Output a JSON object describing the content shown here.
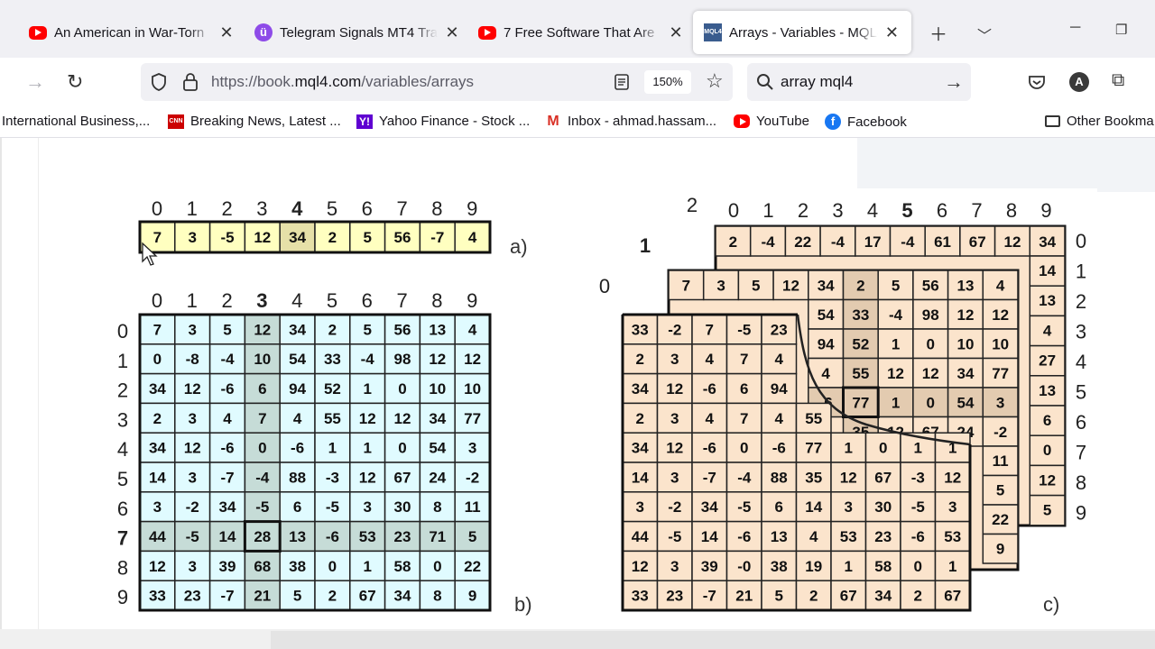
{
  "tabs": [
    {
      "title": "An American in War-Torn",
      "icon": "youtube-icon"
    },
    {
      "title": "Telegram Signals MT4 Tra",
      "icon": "telegram-icon"
    },
    {
      "title": "7 Free Software That Are",
      "icon": "youtube-icon"
    },
    {
      "title": "Arrays - Variables - MQL4",
      "icon": "mql4-icon",
      "active": true
    }
  ],
  "toolbar": {
    "url_prefix": "https://book.",
    "url_domain": "mql4.com",
    "url_path": "/variables/arrays",
    "zoom": "150%",
    "search_query": "array mql4",
    "account_initial": "A"
  },
  "bookmarks": [
    {
      "label": "International Business,...",
      "icon": "none"
    },
    {
      "label": "Breaking News, Latest ...",
      "icon": "cnn-icon",
      "icon_text": "CNN"
    },
    {
      "label": "Yahoo Finance - Stock ...",
      "icon": "yahoo-icon",
      "icon_text": "Y!"
    },
    {
      "label": "Inbox - ahmad.hassam...",
      "icon": "gmail-icon",
      "icon_text": "M"
    },
    {
      "label": "YouTube",
      "icon": "youtube-icon"
    },
    {
      "label": "Facebook",
      "icon": "facebook-icon",
      "icon_text": "f"
    },
    {
      "label": "Other Bookma",
      "icon": "folder-icon"
    }
  ],
  "figure": {
    "label_a": "a)",
    "label_b": "b)",
    "label_c": "c)",
    "col_index": [
      "0",
      "1",
      "2",
      "3",
      "4",
      "5",
      "6",
      "7",
      "8",
      "9"
    ],
    "row_index": [
      "0",
      "1",
      "2",
      "3",
      "4",
      "5",
      "6",
      "7",
      "8",
      "9"
    ],
    "array_1d": [
      "7",
      "3",
      "-5",
      "12",
      "34",
      "2",
      "5",
      "56",
      "-7",
      "4"
    ],
    "array_2d": [
      [
        "7",
        "3",
        "5",
        "12",
        "34",
        "2",
        "5",
        "56",
        "13",
        "4"
      ],
      [
        "0",
        "-8",
        "-4",
        "10",
        "54",
        "33",
        "-4",
        "98",
        "12",
        "12"
      ],
      [
        "34",
        "12",
        "-6",
        "6",
        "94",
        "52",
        "1",
        "0",
        "10",
        "10"
      ],
      [
        "2",
        "3",
        "4",
        "7",
        "4",
        "55",
        "12",
        "12",
        "34",
        "77"
      ],
      [
        "34",
        "12",
        "-6",
        "0",
        "-6",
        "1",
        "1",
        "0",
        "54",
        "3"
      ],
      [
        "14",
        "3",
        "-7",
        "-4",
        "88",
        "-3",
        "12",
        "67",
        "24",
        "-2"
      ],
      [
        "3",
        "-2",
        "34",
        "-5",
        "6",
        "-5",
        "3",
        "30",
        "8",
        "11"
      ],
      [
        "44",
        "-5",
        "14",
        "28",
        "13",
        "-6",
        "53",
        "23",
        "71",
        "5"
      ],
      [
        "12",
        "3",
        "39",
        "68",
        "38",
        "0",
        "1",
        "58",
        "0",
        "22"
      ],
      [
        "33",
        "23",
        "-7",
        "21",
        "5",
        "2",
        "67",
        "34",
        "8",
        "9"
      ]
    ],
    "array_3d_depth_index": [
      "0",
      "1",
      "2"
    ],
    "array_3d_back_row0": [
      "2",
      "-4",
      "22",
      "-4",
      "17",
      "-4",
      "61",
      "67",
      "12",
      "34"
    ],
    "array_3d_back_right": [
      "14",
      "13",
      "4",
      "27",
      "13",
      "6",
      "0",
      "12",
      "5"
    ],
    "array_3d_mid": [
      [
        "7",
        "3",
        "5",
        "12",
        "34",
        "2",
        "5",
        "56",
        "13",
        "4"
      ],
      [
        "",
        "",
        "",
        "",
        "54",
        "33",
        "-4",
        "98",
        "12",
        "12"
      ],
      [
        "",
        "",
        "",
        "",
        "94",
        "52",
        "1",
        "0",
        "10",
        "10"
      ],
      [
        "",
        "",
        "",
        "",
        "4",
        "55",
        "12",
        "12",
        "34",
        "77"
      ],
      [
        "",
        "",
        "",
        "",
        "-6",
        "77",
        "1",
        "0",
        "54",
        "3"
      ],
      [
        "",
        "",
        "",
        "",
        "",
        "35",
        "12",
        "67",
        "24",
        "-2"
      ]
    ],
    "array_3d_mid_right": [
      "11",
      "5",
      "22",
      "9"
    ],
    "array_3d_front": [
      [
        "33",
        "-2",
        "7",
        "-5",
        "23",
        "",
        "",
        "",
        "",
        ""
      ],
      [
        "2",
        "3",
        "4",
        "7",
        "4",
        "",
        "",
        "",
        "",
        ""
      ],
      [
        "34",
        "12",
        "-6",
        "6",
        "94",
        "",
        "",
        "",
        "",
        ""
      ],
      [
        "2",
        "3",
        "4",
        "7",
        "4",
        "55",
        "",
        "",
        "",
        ""
      ],
      [
        "34",
        "12",
        "-6",
        "0",
        "-6",
        "77",
        "1",
        "0",
        "1",
        "1"
      ],
      [
        "14",
        "3",
        "-7",
        "-4",
        "88",
        "35",
        "12",
        "67",
        "-3",
        "12"
      ],
      [
        "3",
        "-2",
        "34",
        "-5",
        "6",
        "14",
        "3",
        "30",
        "-5",
        "3"
      ],
      [
        "44",
        "-5",
        "14",
        "-6",
        "13",
        "4",
        "53",
        "23",
        "-6",
        "53"
      ],
      [
        "12",
        "3",
        "39",
        "-0",
        "38",
        "19",
        "1",
        "58",
        "0",
        "1"
      ],
      [
        "33",
        "23",
        "-7",
        "21",
        "5",
        "2",
        "67",
        "34",
        "2",
        "67"
      ]
    ]
  },
  "colors": {
    "row_1d": "#ffffc0",
    "grid_2d": "#e0fbff",
    "highlight_2d": "#c6dcd7",
    "grid_3d": "#fbe4cc",
    "highlight_3d": "#e3cbb0",
    "selected_value": "#a00000"
  }
}
